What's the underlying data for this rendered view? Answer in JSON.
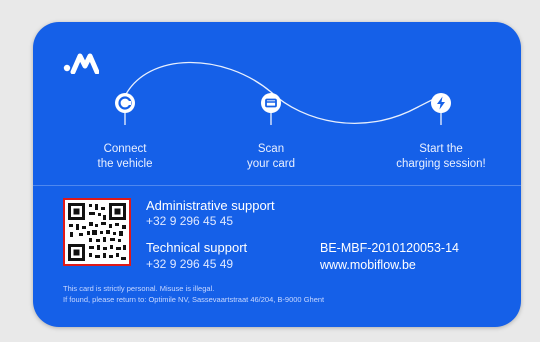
{
  "card": {
    "background": "#1560e8",
    "steps": [
      {
        "icon": "car-connector-icon",
        "line1": "Connect",
        "line2": "the vehicle"
      },
      {
        "icon": "card-scan-icon",
        "line1": "Scan",
        "line2": "your card"
      },
      {
        "icon": "lightning-icon",
        "line1": "Start the",
        "line2": "charging session!"
      }
    ],
    "support": {
      "admin_title": "Administrative support",
      "admin_phone": "+32 9 296 45 45",
      "tech_title": "Technical support",
      "tech_phone": "+32 9 296 45 49"
    },
    "reference": {
      "card_id": "BE-MBF-2010120053-14",
      "website": "www.mobiflow.be"
    },
    "footer": {
      "line1": "This card is strictly personal. Misuse is illegal.",
      "line2": "If found, please return to: Optimile NV, Sassevaartstraat 46/204, B-9000 Ghent"
    },
    "qr_icon": "qr-code-icon",
    "logo_icon": "mobiflow-logo-icon"
  }
}
